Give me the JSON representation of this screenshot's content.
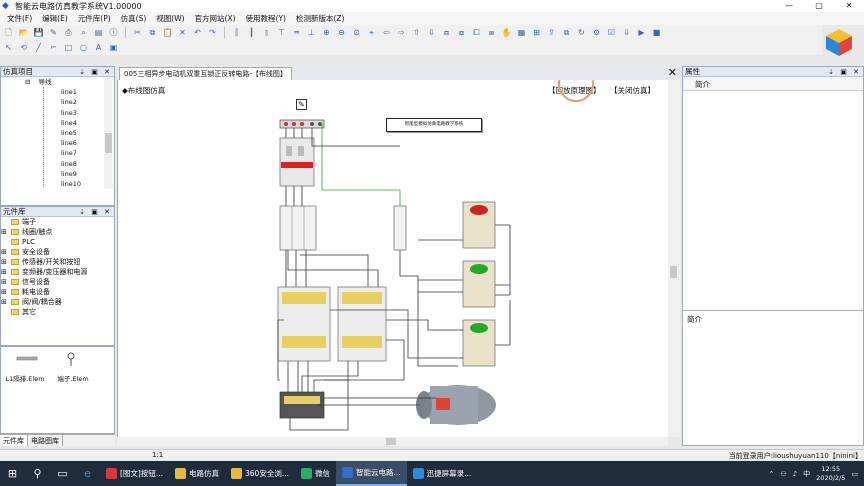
{
  "window": {
    "title": "智能云电路仿真教学系统V1.00000",
    "min": "—",
    "max": "▢",
    "close": "✕"
  },
  "menu": [
    "文件(F)",
    "编辑(E)",
    "元件库(P)",
    "仿真(S)",
    "视图(W)",
    "官方网站(X)",
    "使用教程(Y)",
    "检测新版本(Z)"
  ],
  "project_panel": {
    "title": "仿真项目",
    "controls": "⇣ ▣ ✕",
    "tree_root": "导线",
    "tree_items": [
      "line1",
      "line2",
      "line3",
      "line4",
      "line5",
      "line6",
      "line7",
      "line8",
      "line9",
      "line10"
    ]
  },
  "library_panel": {
    "title": "元件库",
    "controls": "⇣ ▣ ✕",
    "items": [
      {
        "label": "端子",
        "expand": ""
      },
      {
        "label": "线圈/触点",
        "expand": "⊞"
      },
      {
        "label": "PLC",
        "expand": ""
      },
      {
        "label": "安全设备",
        "expand": "⊞"
      },
      {
        "label": "传感器/开关和按钮",
        "expand": "⊞"
      },
      {
        "label": "变频器/变压器和电源",
        "expand": "⊞"
      },
      {
        "label": "信号设备",
        "expand": "⊞"
      },
      {
        "label": "耗电设备",
        "expand": "⊞"
      },
      {
        "label": "阀/阀/耦合器",
        "expand": "⊞"
      },
      {
        "label": "其它",
        "expand": ""
      }
    ]
  },
  "element_tiles": [
    {
      "label": "L1隔排.Elem"
    },
    {
      "label": "端子.Elem"
    }
  ],
  "bottom_tabs": [
    "元件库",
    "电路图库"
  ],
  "document": {
    "tab_title": "005三相异步电动机双重互锁正反转电路-【布线图】",
    "close": "✕",
    "canvas_caption": "◆布线图仿真",
    "btn_circuit": "【回放原理图】",
    "btn_close_sim": "【关闭仿真】",
    "sign_text": "智能型模拟仿真电路教学系统",
    "edit_icon": "✎"
  },
  "properties": {
    "title": "属性",
    "controls": "⇣ ▣ ✕",
    "header": "简介",
    "intro": "简介"
  },
  "status": {
    "zoom": "1:1",
    "user": "当前登录用户:lioushuyuan110【ninini】"
  },
  "taskbar": {
    "start": "⊞",
    "tasks": [
      {
        "label": "[图文]按钮...",
        "color": "#d33b3b",
        "active": false
      },
      {
        "label": "电路仿真",
        "color": "#e7b93c",
        "active": false
      },
      {
        "label": "360安全浏...",
        "color": "#e7b93c",
        "active": false
      },
      {
        "label": "微信",
        "color": "#2aae67",
        "active": false
      },
      {
        "label": "智能云电路...",
        "color": "#2f6fc9",
        "active": true
      },
      {
        "label": "迅捷屏幕录...",
        "color": "#2f8bd6",
        "active": false
      }
    ],
    "clock_time": "12:55",
    "clock_date": "2020/2/5"
  },
  "colors": {
    "taskbar": "#1f2c3e",
    "accent": "#2f6fc9",
    "highlight_ring": "#e89a6a"
  }
}
